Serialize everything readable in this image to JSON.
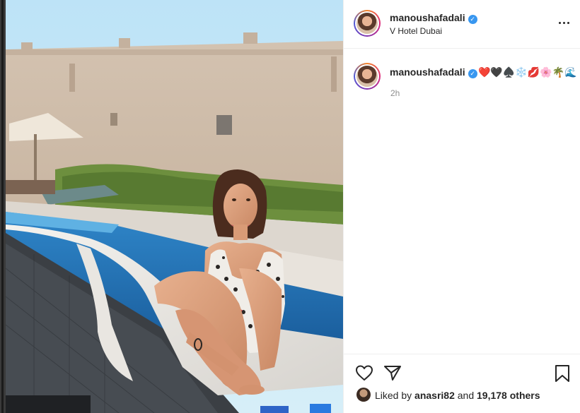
{
  "post": {
    "username": "manoushafadali",
    "verified_mark": "✓",
    "location": "V Hotel Dubai",
    "caption": "❤️🖤♠️❄️💋🌸🌴🌊",
    "time_ago": "2h",
    "liked_by_prefix": "Liked by",
    "liked_by_user": "anasri82",
    "liked_by_and": "and",
    "liked_by_others": "19,178 others"
  },
  "icons": {
    "more": "more-options-icon",
    "like": "heart-icon",
    "share": "paper-plane-icon",
    "save": "bookmark-icon",
    "verified": "verified-badge-icon"
  },
  "colors": {
    "verified_blue": "#3897f0",
    "text": "#262626",
    "muted": "#8e8e8e",
    "divider": "#efefef"
  }
}
